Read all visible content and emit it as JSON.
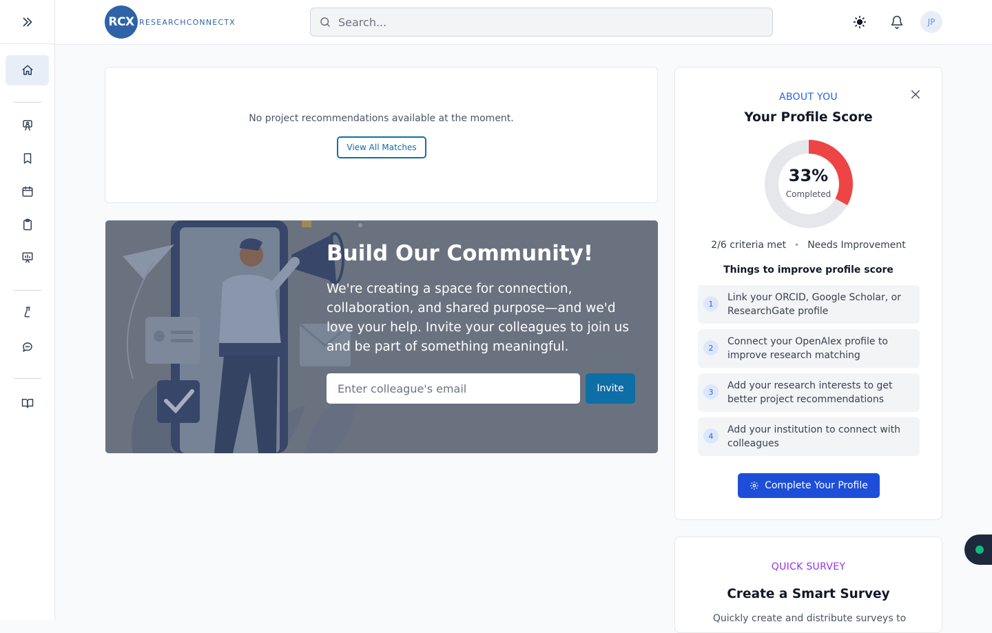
{
  "header": {
    "logo_initials": "RCX",
    "logo_text": "RESEARCHCONNECTX",
    "search_placeholder": "Search...",
    "avatar_initials": "JP"
  },
  "recommendations": {
    "empty_text": "No project recommendations available at the moment.",
    "button_label": "View All Matches"
  },
  "community": {
    "title": "Build Our Community!",
    "description": "We're creating a space for connection, collaboration, and shared purpose—and we'd love your help. Invite your colleagues to join us and be part of something meaningful.",
    "email_placeholder": "Enter colleague's email",
    "invite_label": "Invite"
  },
  "profile": {
    "eyebrow": "ABOUT YOU",
    "title": "Your Profile Score",
    "score_percent": 33,
    "score_text": "33%",
    "score_label": "Completed",
    "criteria_text": "2/6 criteria met",
    "status_text": "Needs Improvement",
    "improve_title": "Things to improve profile score",
    "tips": [
      {
        "num": "1",
        "text": "Link your ORCID, Google Scholar, or ResearchGate profile"
      },
      {
        "num": "2",
        "text": "Connect your OpenAlex profile to improve research matching"
      },
      {
        "num": "3",
        "text": "Add your research interests to get better project recommendations"
      },
      {
        "num": "4",
        "text": "Add your institution to connect with colleagues"
      }
    ],
    "button_label": "Complete Your Profile",
    "ring_color": "#ef4444",
    "track_color": "#e5e7eb"
  },
  "survey": {
    "eyebrow": "QUICK SURVEY",
    "title": "Create a Smart Survey",
    "description": "Quickly create and distribute surveys to"
  },
  "colors": {
    "primary": "#0e6ea6",
    "brand": "#2f63a8",
    "accent_blue": "#1d4ed8",
    "survey_purple": "#9333ea"
  },
  "icons": {
    "sidebar": [
      "chevrons-right-icon",
      "home-icon",
      "presentation-user-icon",
      "bookmark-icon",
      "calendar-icon",
      "clipboard-icon",
      "chart-board-icon",
      "flask-icon",
      "chat-icon",
      "book-open-icon"
    ],
    "header": [
      "search-icon",
      "sun-icon",
      "bell-icon"
    ]
  }
}
